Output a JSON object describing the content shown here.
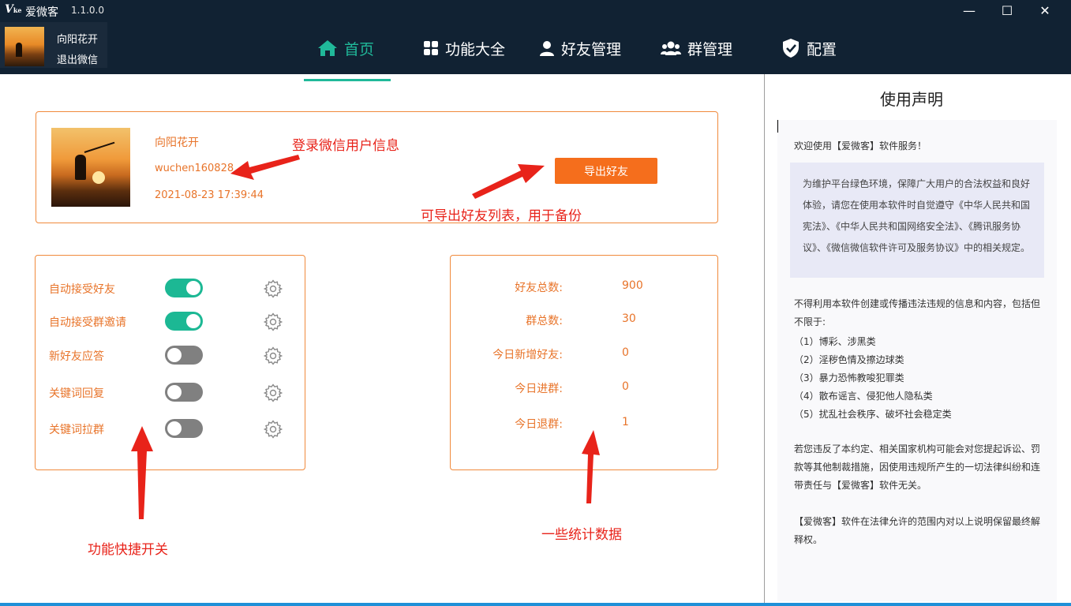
{
  "titlebar": {
    "app_name": "爱微客",
    "version": "1.1.0.0",
    "logo_text": "V",
    "logo_sub": "ke",
    "minimize": "—",
    "maximize": "☐",
    "close": "✕"
  },
  "account": {
    "nickname": "向阳花开",
    "logout_label": "退出微信"
  },
  "nav": {
    "items": [
      {
        "label": "首页",
        "icon": "home-icon",
        "active": true
      },
      {
        "label": "功能大全",
        "icon": "grid-icon",
        "active": false
      },
      {
        "label": "好友管理",
        "icon": "user-icon",
        "active": false
      },
      {
        "label": "群管理",
        "icon": "users-icon",
        "active": false
      },
      {
        "label": "配置",
        "icon": "shield-check-icon",
        "active": false
      }
    ],
    "accent_color": "#20b99a"
  },
  "user_card": {
    "nickname": "向阳花开",
    "wxid": "wuchen160828",
    "login_time": "2021-08-23 17:39:44",
    "export_button": "导出好友"
  },
  "switches": [
    {
      "label": "自动接受好友",
      "on": true
    },
    {
      "label": "自动接受群邀请",
      "on": true
    },
    {
      "label": "新好友应答",
      "on": false
    },
    {
      "label": "关键词回复",
      "on": false
    },
    {
      "label": "关键词拉群",
      "on": false
    }
  ],
  "stats": [
    {
      "label": "好友总数:",
      "value": "900"
    },
    {
      "label": "群总数:",
      "value": "30"
    },
    {
      "label": "今日新增好友:",
      "value": "0"
    },
    {
      "label": "今日进群:",
      "value": "0"
    },
    {
      "label": "今日退群:",
      "value": "1"
    }
  ],
  "annotations": {
    "user_info": "登录微信用户信息",
    "export": "可导出好友列表，用于备份",
    "switches": "功能快捷开关",
    "stats": "一些统计数据"
  },
  "declaration": {
    "title": "使用声明",
    "welcome": "欢迎使用【爱微客】软件服务！",
    "box_text": "为维护平台绿色环境，保障广大用户的合法权益和良好体验，请您在使用本软件时自觉遵守《中华人民共和国宪法》、《中华人民共和国网络安全法》、《腾讯服务协议》、《微信微信软件许可及服务协议》中的相关规定。",
    "intro": "不得利用本软件创建或传播违法违规的信息和内容，包括但不限于:",
    "list": [
      "（1）博彩、涉黑类",
      "（2）淫秽色情及擦边球类",
      "（3）暴力恐怖教唆犯罪类",
      "（4）散布谣言、侵犯他人隐私类",
      "（5）扰乱社会秩序、破坏社会稳定类"
    ],
    "violation": "若您违反了本约定、相关国家机构可能会对您提起诉讼、罚款等其他制裁措施，因使用违规所产生的一切法律纠纷和连带责任与【爱微客】软件无关。",
    "final": "【爱微客】软件在法律允许的范围内对以上说明保留最终解释权。"
  },
  "colors": {
    "header_bg": "#112233",
    "card_border": "#f08a3c",
    "text_orange": "#e8742a",
    "button_orange": "#f56e1c",
    "toggle_on": "#1cb894",
    "toggle_off": "#808080",
    "annotation_red": "#e8231a"
  }
}
